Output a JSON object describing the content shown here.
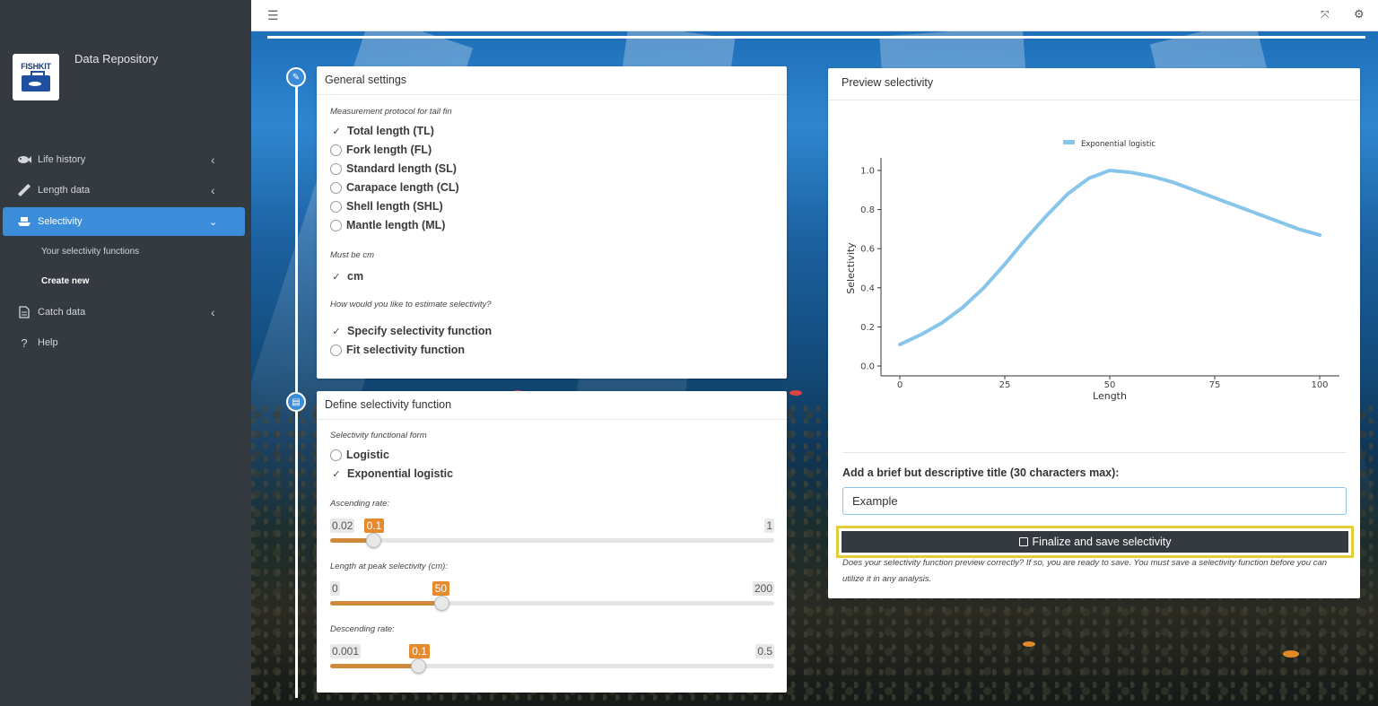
{
  "app": {
    "title": "Data Repository",
    "logo_text": "FISHKIT"
  },
  "sidebar": {
    "items": [
      {
        "label": "Life history",
        "icon": "fish-icon"
      },
      {
        "label": "Length data",
        "icon": "ruler-icon"
      },
      {
        "label": "Selectivity",
        "icon": "ship-icon"
      },
      {
        "label": "Catch data",
        "icon": "file-icon"
      },
      {
        "label": "Help",
        "icon": "question-icon"
      }
    ],
    "subitems": [
      {
        "label": "Your selectivity functions"
      },
      {
        "label": "Create new"
      }
    ]
  },
  "general": {
    "title": "General settings",
    "protocol_label": "Measurement protocol for tail fin",
    "protocols": [
      "Total length (TL)",
      "Fork length (FL)",
      "Standard length (SL)",
      "Carapace length (CL)",
      "Shell length (SHL)",
      "Mantle length (ML)"
    ],
    "selected_protocol": 0,
    "unit_label": "Must be cm",
    "unit": "cm",
    "estimate_label": "How would you like to estimate selectivity?",
    "estimate_options": [
      "Specify selectivity function",
      "Fit selectivity function"
    ],
    "selected_estimate": 0
  },
  "define": {
    "title": "Define selectivity function",
    "form_label": "Selectivity functional form",
    "forms": [
      "Logistic",
      "Exponential logistic"
    ],
    "selected_form": 1,
    "sliders": [
      {
        "label": "Ascending rate:",
        "min": "0.02",
        "max": "1",
        "value": "0.1",
        "fraction": 0.0962
      },
      {
        "label": "Length at peak selectivity (cm):",
        "min": "0",
        "max": "200",
        "value": "50",
        "fraction": 0.25
      },
      {
        "label": "Descending rate:",
        "min": "0.001",
        "max": "0.5",
        "value": "0.1",
        "fraction": 0.1984
      }
    ]
  },
  "preview": {
    "title": "Preview selectivity",
    "title_field_label": "Add a brief but descriptive title (30 characters max):",
    "title_value": "Example",
    "save_label": "Finalize and save selectivity",
    "save_note": "Does your selectivity function preview correctly? If so, you are ready to save. You must save a selectivity function before you can utilize it in any analysis."
  },
  "chart_data": {
    "type": "line",
    "title": "",
    "xlabel": "Length",
    "ylabel": "Selectivity",
    "xlim": [
      0,
      100
    ],
    "ylim": [
      0,
      1
    ],
    "xticks": [
      "0",
      "25",
      "50",
      "75",
      "100"
    ],
    "yticks": [
      "0.0",
      "0.2",
      "0.4",
      "0.6",
      "0.8",
      "1.0"
    ],
    "legend": "top-center",
    "color": "#87c5ea",
    "series": [
      {
        "name": "Exponential logistic",
        "x": [
          0,
          5,
          10,
          15,
          20,
          25,
          30,
          35,
          40,
          45,
          50,
          55,
          60,
          65,
          70,
          75,
          80,
          85,
          90,
          95,
          100
        ],
        "values": [
          0.11,
          0.16,
          0.22,
          0.3,
          0.4,
          0.52,
          0.65,
          0.77,
          0.88,
          0.96,
          1.0,
          0.99,
          0.97,
          0.94,
          0.9,
          0.86,
          0.82,
          0.78,
          0.74,
          0.7,
          0.67
        ]
      }
    ]
  }
}
